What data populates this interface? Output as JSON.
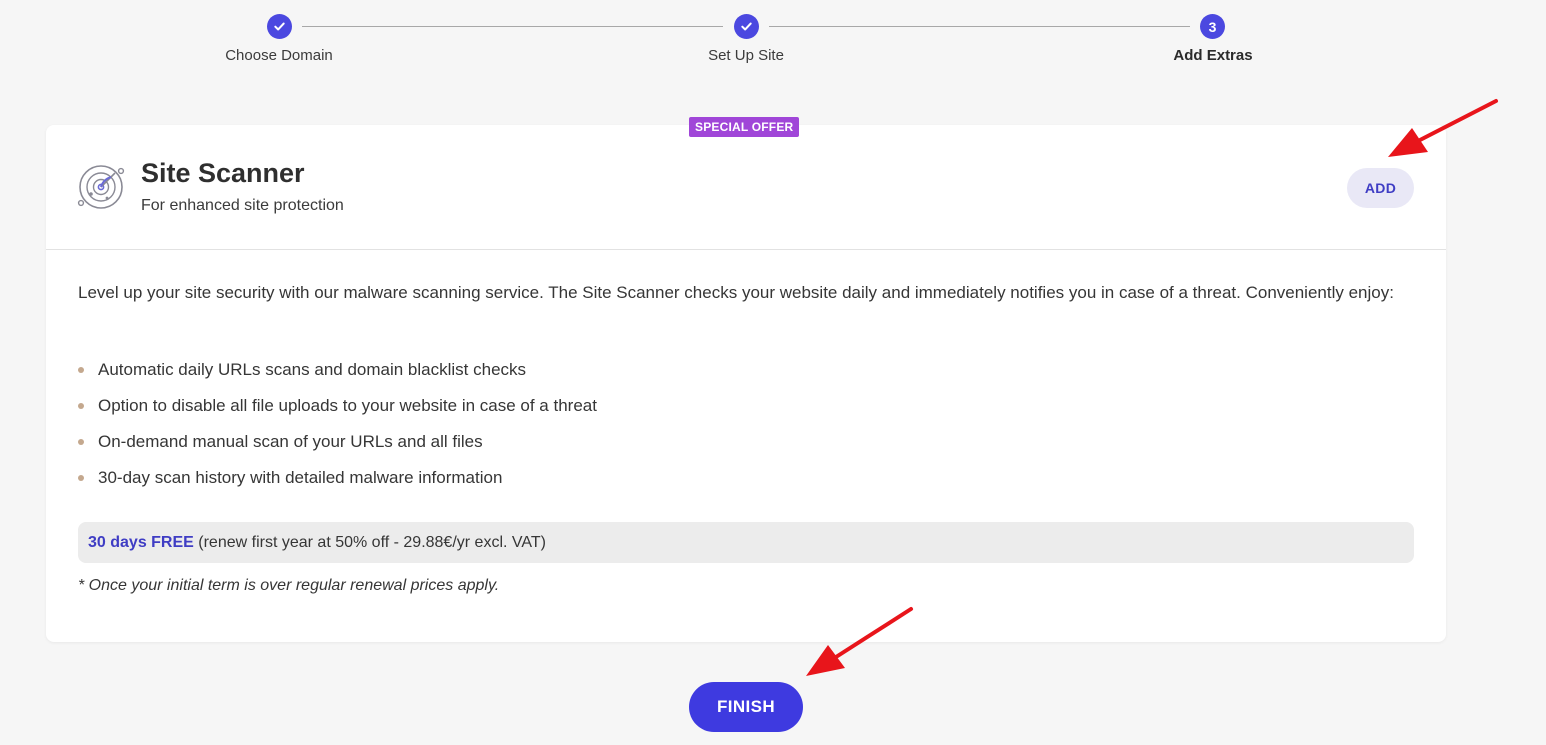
{
  "stepper": {
    "steps": [
      {
        "label": "Choose Domain",
        "state": "done"
      },
      {
        "label": "Set Up Site",
        "state": "done"
      },
      {
        "label": "Add Extras",
        "state": "current",
        "number": "3"
      }
    ]
  },
  "product": {
    "badge": "SPECIAL OFFER",
    "title": "Site Scanner",
    "subtitle": "For enhanced site protection",
    "add_label": "ADD",
    "description": "Level up your site security with our malware scanning service. The Site Scanner checks your website daily and immediately notifies you in case of a threat. Conveniently enjoy:",
    "features": [
      "Automatic daily URLs scans and domain blacklist checks",
      "Option to disable all file uploads to your website in case of a threat",
      "On-demand manual scan of your URLs and all files",
      "30-day scan history with detailed malware information"
    ],
    "price_highlight": "30 days FREE",
    "price_detail": " (renew first year at 50% off - 29.88€/yr excl. VAT)",
    "footnote": "*  Once your initial term is over regular renewal prices apply."
  },
  "finish_label": "FINISH",
  "colors": {
    "accent": "#3e3ae0",
    "badge": "#a046d8",
    "annotation_arrow": "#e8151b"
  }
}
